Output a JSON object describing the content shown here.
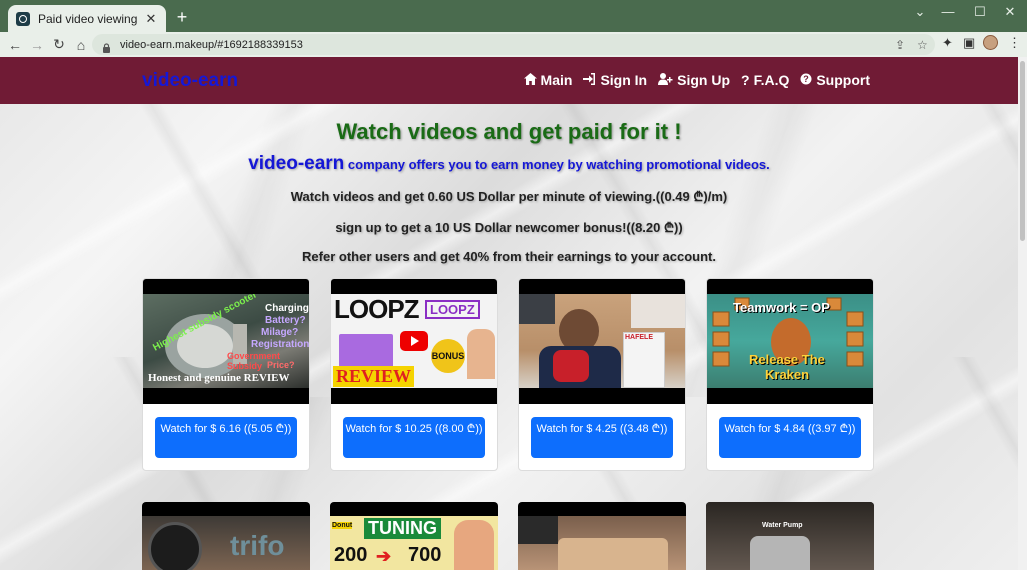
{
  "browser": {
    "tab_title": "Paid video viewing",
    "url": "video-earn.makeup/#1692188339153"
  },
  "site": {
    "brand": "video-earn",
    "nav": [
      {
        "icon": "home-icon",
        "label": "Main"
      },
      {
        "icon": "sign-in-icon",
        "label": "Sign In"
      },
      {
        "icon": "user-plus-icon",
        "label": "Sign Up"
      },
      {
        "icon": "question-icon",
        "label": "F.A.Q"
      },
      {
        "icon": "support-icon",
        "label": "Support"
      }
    ]
  },
  "hero": {
    "headline": "Watch videos and get paid for it !",
    "company": "video-earn",
    "company_tail": "company offers you to earn money by watching promotional videos.",
    "line1": "Watch videos and get 0.60 US Dollar per minute of viewing.((0.49 ₾)/m)",
    "line2": "sign up to get a 10 US Dollar newcomer bonus!((8.20 ₾))",
    "line3": "Refer other users and get 40% from their earnings to your account."
  },
  "videos": [
    {
      "button": "Watch for $ 6.16 ((5.05 ₾))",
      "overlay": [
        "Highest subsidy scooter",
        "Charging",
        "Battery?",
        "Milage?",
        "Registration?",
        "Government Subsidy",
        "Price?",
        "Honest and genuine REVIEW"
      ]
    },
    {
      "button": "Watch for $ 10.25 ((8.00 ₾))",
      "overlay": [
        "LOOPZ",
        "LOOPZ",
        "BONUS",
        "REVIEW"
      ]
    },
    {
      "button": "Watch for $ 4.25 ((3.48 ₾))",
      "overlay": [
        "HAFELE"
      ]
    },
    {
      "button": "Watch for $ 4.84 ((3.97 ₾))",
      "overlay": [
        "Teamwork = OP",
        "Release The",
        "Kraken"
      ]
    }
  ],
  "videos_row2": [
    {
      "overlay": [
        "trifo"
      ]
    },
    {
      "overlay": [
        "TUNING",
        "200",
        "700"
      ]
    },
    {
      "overlay": []
    },
    {
      "overlay": [
        "Water Pump"
      ]
    }
  ]
}
